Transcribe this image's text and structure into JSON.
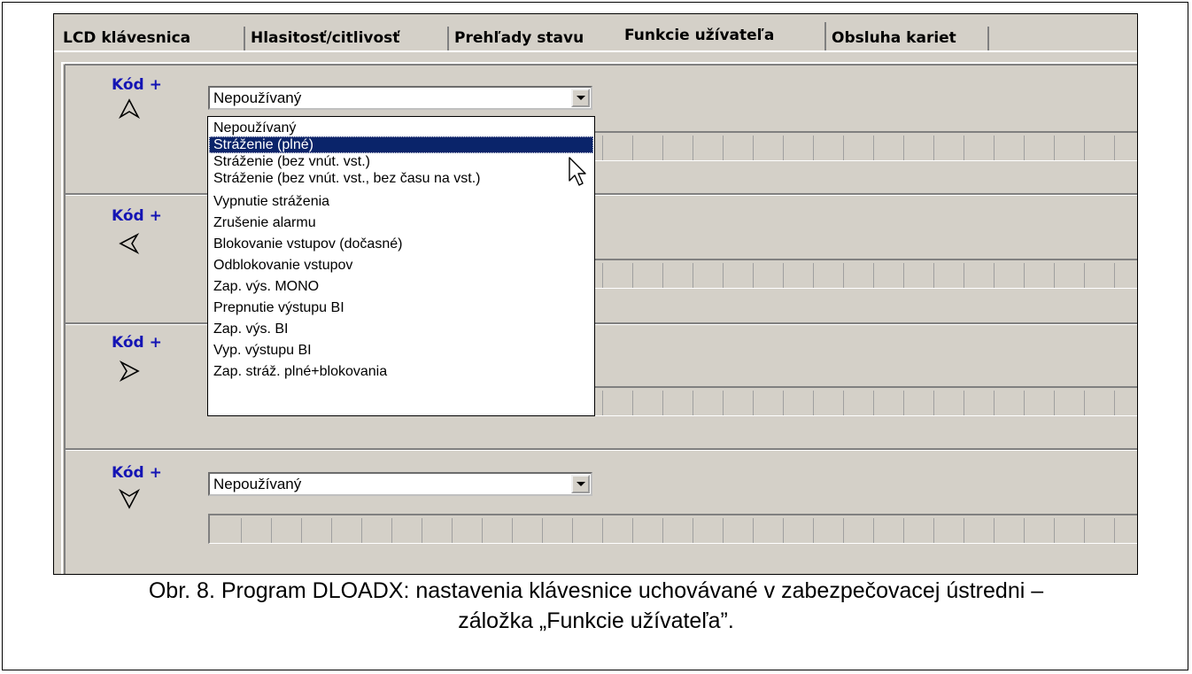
{
  "tabs": [
    {
      "label": "LCD klávesnica"
    },
    {
      "label": "Hlasitosť/citlivosť"
    },
    {
      "label": "Prehľady stavu"
    },
    {
      "label": "Funkcie užívateľa",
      "active": true
    },
    {
      "label": "Obsluha kariet"
    }
  ],
  "groups": [
    {
      "kod_label": "Kód +",
      "arrow": "arrow-up-icon",
      "select_value": "Nepoužívaný"
    },
    {
      "kod_label": "Kód +",
      "arrow": "arrow-left-icon",
      "select_value": ""
    },
    {
      "kod_label": "Kód +",
      "arrow": "arrow-right-icon",
      "select_value": ""
    },
    {
      "kod_label": "Kód +",
      "arrow": "arrow-down-icon",
      "select_value": "Nepoužívaný"
    }
  ],
  "dropdown": {
    "selected_index": 1,
    "options": [
      "Nepoužívaný",
      "Stráženie (plné)",
      "Stráženie (bez vnút. vst.)",
      "Stráženie (bez vnút. vst., bez času na vst.)",
      "Vypnutie stráženia",
      "Zrušenie alarmu",
      "Blokovanie vstupov (dočasné)",
      "Odblokovanie vstupov",
      "Zap. výs. MONO",
      "Prepnutie výstupu BI",
      "Zap. výs. BI",
      "Vyp. výstupu BI",
      "Zap. stráž. plné+blokovania"
    ]
  },
  "caption": {
    "line1": "Obr. 8. Program DLOADX: nastavenia klávesnice uchovávané v zabezpečovacej ústredni –",
    "line2": "záložka „Funkcie užívateľa”."
  },
  "colors": {
    "window_bg": "#d4d0c8",
    "kod_label": "#1414b4",
    "selection": "#0a246a"
  }
}
